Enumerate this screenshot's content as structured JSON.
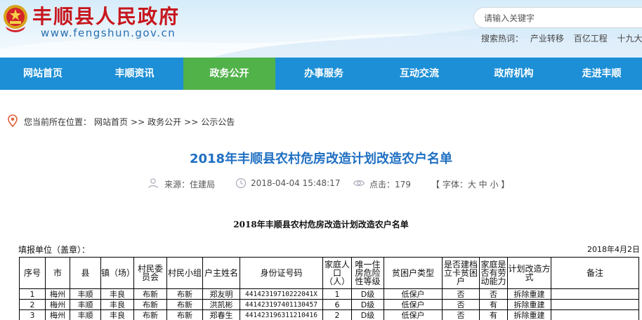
{
  "site": {
    "title": "丰顺县人民政府",
    "url": "www.fengshun.gov.cn",
    "emblem_icon": "national-emblem-icon",
    "brand_color": "#c8161d"
  },
  "search": {
    "placeholder": "请输入关键字",
    "hotwords_label": "搜索热词：",
    "hotwords": [
      "产业转移",
      "百亿工程",
      "十九大"
    ]
  },
  "nav": {
    "items": [
      "网站首页",
      "丰顺资讯",
      "政务公开",
      "办事服务",
      "互动交流",
      "政府机构",
      "走进丰顺"
    ],
    "active_index": 2,
    "color": "#1c8fd6",
    "active_color": "#52b24a"
  },
  "breadcrumb": {
    "prefix": "您当前所在位置：",
    "items": [
      "网站首页",
      "政务公开",
      "公示公告"
    ],
    "separator": ">>"
  },
  "article": {
    "title": "2018年丰顺县农村危房改造计划改造农户名单",
    "source": "来源：住建局",
    "date": "2018-04-04 15:48:17",
    "clicks": "点击：179",
    "font_size": "【 字体：大 中 小 】"
  },
  "document": {
    "title": "2018年丰顺县农村危房改造计划改造农户名单",
    "fill_unit": "填报单位（盖章）：",
    "fill_date": "2018年4月2日",
    "columns": [
      "序号",
      "市",
      "县",
      "镇（场）",
      "村民委员会",
      "村民小组",
      "户主姓名",
      "身份证号码",
      "家庭人口（人）",
      "唯一住房危险性等级",
      "贫困户类型",
      "是否建档立卡贫困户",
      "家庭是否有劳动能力",
      "计划改造方式",
      "备注"
    ],
    "rows": [
      [
        "1",
        "梅州",
        "丰顺",
        "丰良",
        "布新",
        "布新",
        "郑友明",
        "44142319710222041X",
        "1",
        "D级",
        "低保户",
        "否",
        "否",
        "拆除重建",
        ""
      ],
      [
        "2",
        "梅州",
        "丰顺",
        "丰良",
        "布新",
        "布新",
        "洪凯彬",
        "441423197401130457",
        "6",
        "D级",
        "低保户",
        "否",
        "有",
        "拆除重建",
        ""
      ],
      [
        "3",
        "梅州",
        "丰顺",
        "丰良",
        "布新",
        "布新",
        "郑春生",
        "441423196311210416",
        "2",
        "D级",
        "低保户",
        "否",
        "有",
        "拆除重建",
        ""
      ]
    ]
  }
}
